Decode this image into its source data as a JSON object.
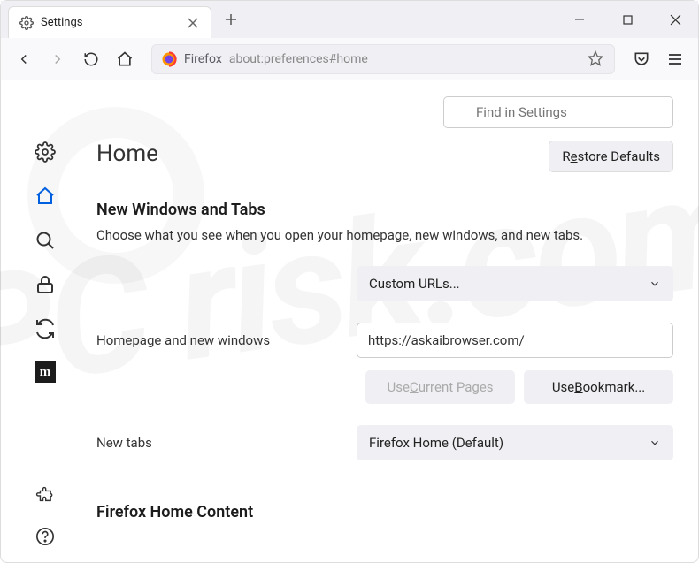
{
  "tab": {
    "title": "Settings"
  },
  "urlbar": {
    "label": "Firefox",
    "text": "about:preferences#home"
  },
  "search": {
    "placeholder": "Find in Settings"
  },
  "heading": "Home",
  "restore_btn": {
    "pre": "R",
    "u": "e",
    "post": "store Defaults"
  },
  "section": {
    "title": "New Windows and Tabs",
    "desc": "Choose what you see when you open your homepage, new windows, and new tabs."
  },
  "homepage": {
    "dropdown": "Custom URLs...",
    "label": "Homepage and new windows",
    "value": "https://askaibrowser.com/",
    "current_pages": {
      "pre": "Use ",
      "u": "C",
      "post": "urrent Pages"
    },
    "use_bookmark": {
      "pre": "Use ",
      "u": "B",
      "post": "ookmark..."
    }
  },
  "newtabs": {
    "label": "New tabs",
    "dropdown": "Firefox Home (Default)"
  },
  "firefox_home_content": "Firefox Home Content"
}
